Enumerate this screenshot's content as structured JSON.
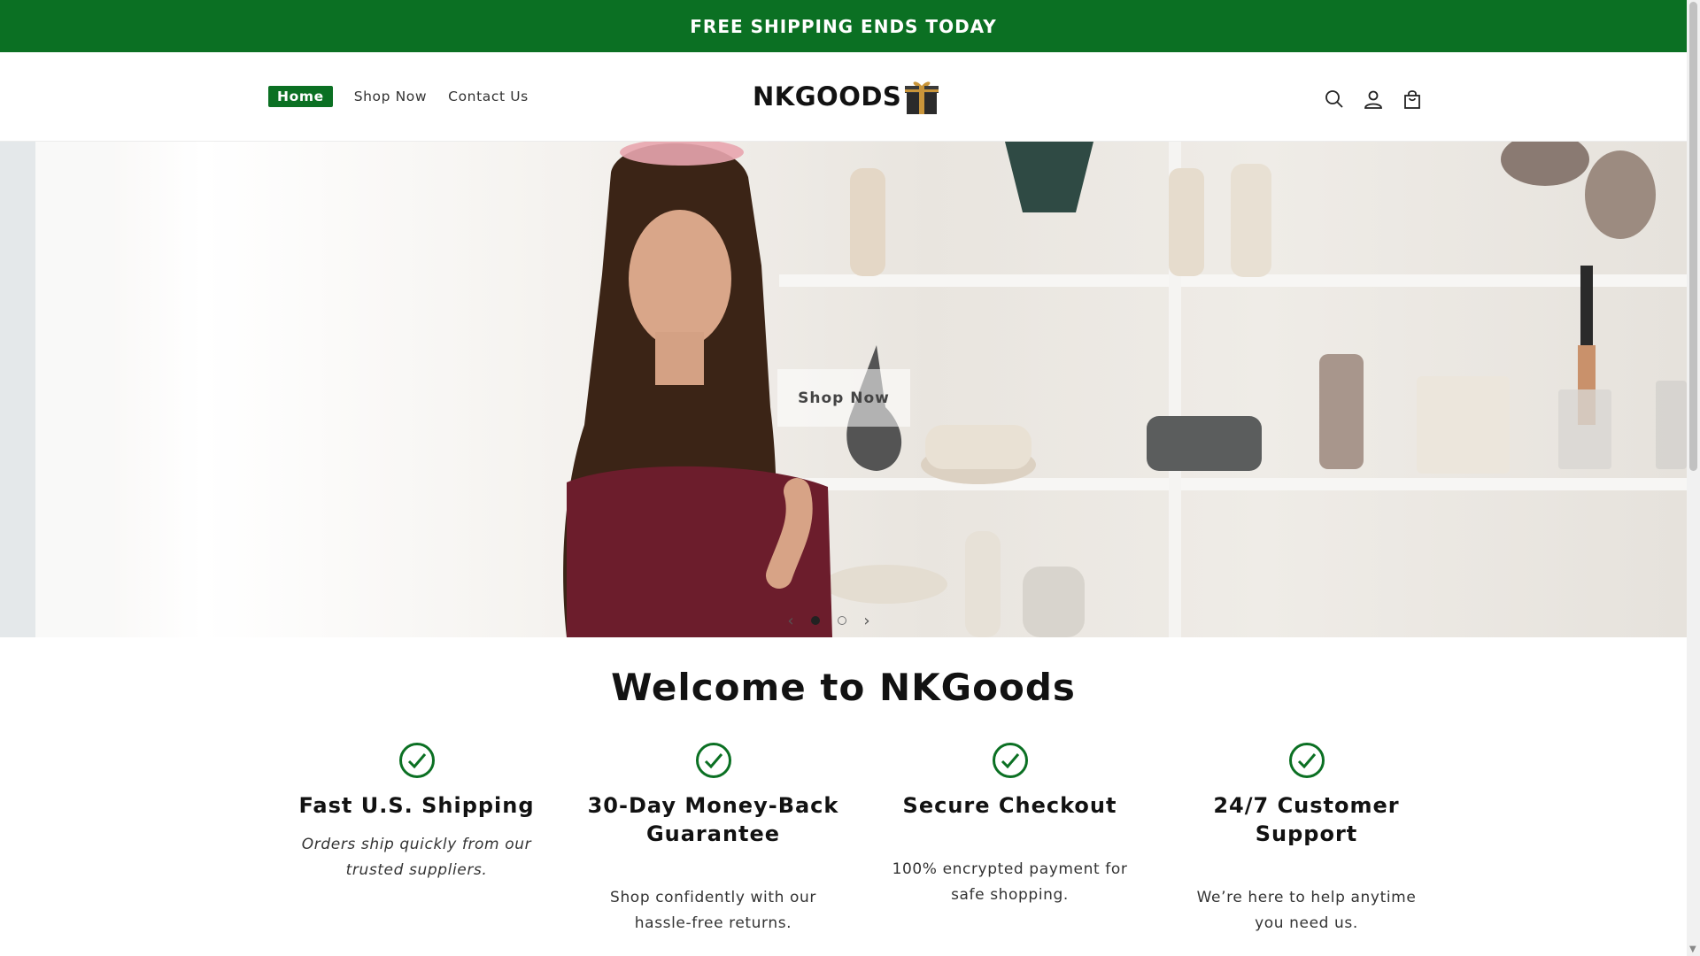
{
  "announcement": {
    "text": "FREE SHIPPING ENDS TODAY"
  },
  "nav": {
    "items": [
      {
        "label": "Home",
        "active": true
      },
      {
        "label": "Shop Now",
        "active": false
      },
      {
        "label": "Contact Us",
        "active": false
      }
    ]
  },
  "logo": {
    "text": "NKGOODS"
  },
  "header_icons": [
    "search-icon",
    "account-icon",
    "cart-icon"
  ],
  "hero": {
    "button_label": "Shop Now",
    "prev": "‹",
    "next": "›",
    "slides": 2,
    "active_slide": 1
  },
  "welcome": {
    "title": "Welcome to NKGoods"
  },
  "features": [
    {
      "title": "Fast U.S. Shipping",
      "text": "Orders ship quickly from our trusted suppliers.",
      "italic": true
    },
    {
      "title": "30-Day Money-Back Guarantee",
      "text": "Shop confidently with our hassle-free returns.",
      "italic": false
    },
    {
      "title": "Secure Checkout",
      "text": "100% encrypted payment for safe shopping.",
      "italic": false
    },
    {
      "title": "24/7 Customer Support",
      "text": "We’re here to help anytime you need us.",
      "italic": false
    }
  ],
  "colors": {
    "brand_green": "#0b7023",
    "text": "#121212"
  }
}
